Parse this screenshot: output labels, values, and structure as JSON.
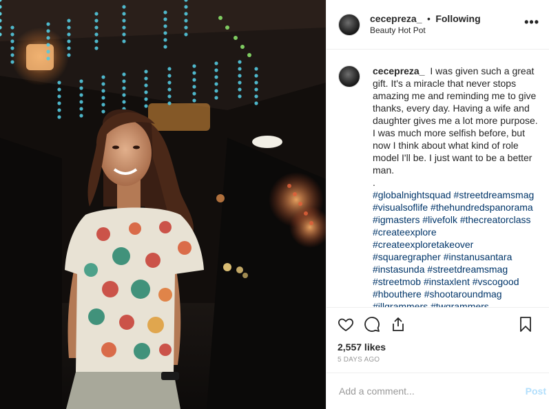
{
  "header": {
    "username": "cecepreza_",
    "separator": "•",
    "follow_status": "Following",
    "location": "Beauty Hot Pot",
    "more_label": "•••"
  },
  "caption": {
    "username": "cecepreza_",
    "text": "I was given such a great gift. It's a miracle that never stops amazing me and reminding me to give thanks, every day. Having a wife and daughter gives me a lot more purpose. I was much more selfish before, but now I think about what kind of role model I'll be. I just want to be a better man.",
    "dot": ".",
    "hashtags": [
      "#globalnightsquad",
      "#streetdreamsmag",
      "#visualsoflife",
      "#thehundredspanorama",
      "#igmasters",
      "#livefolk",
      "#thecreatorclass",
      "#createexplore",
      "#createexploretakeover",
      "#squaregrapher",
      "#instanusantara",
      "#instasunda",
      "#streetdreamsmag",
      "#streetmob",
      "#instaxlent",
      "#vscogood",
      "#hbouthere",
      "#shootaroundmag",
      "#illgrammers",
      "#twgrammers"
    ]
  },
  "actions": {
    "like_icon": "heart-icon",
    "comment_icon": "speech-bubble-icon",
    "share_icon": "share-icon",
    "save_icon": "bookmark-icon"
  },
  "likes": "2,557 likes",
  "timestamp": "5 DAYS AGO",
  "comment_input": {
    "placeholder": "Add a comment...",
    "post_label": "Post"
  },
  "colors": {
    "hashtag": "#003569",
    "post_disabled": "#b2dffc",
    "muted": "#999999"
  }
}
